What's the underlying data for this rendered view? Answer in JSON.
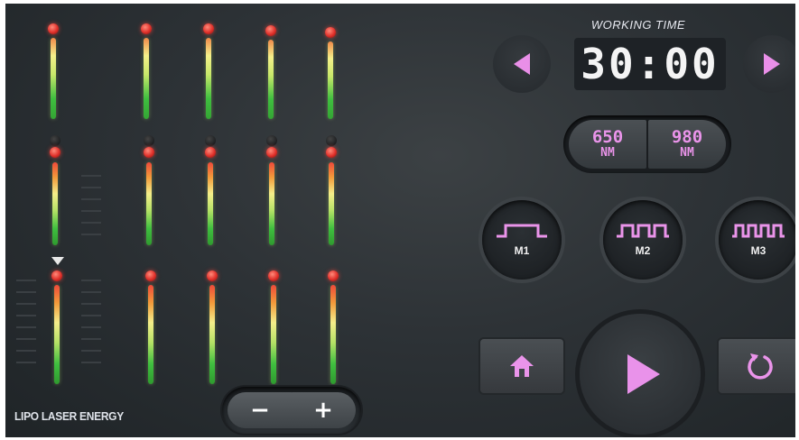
{
  "energy_label": "LIPO LASER ENERGY",
  "controls": {
    "minus_label": "−",
    "plus_label": "+"
  },
  "working_time": {
    "label": "WORKING TIME",
    "value": "30:00"
  },
  "wavelengths": [
    {
      "value": "650",
      "unit": "NM"
    },
    {
      "value": "980",
      "unit": "NM"
    }
  ],
  "modes": [
    {
      "label": "M1"
    },
    {
      "label": "M2"
    },
    {
      "label": "M3"
    }
  ],
  "colors": {
    "accent": "#e98fe8",
    "background": "#2d3236",
    "indicator_red": "#e0302a",
    "indicator_green": "#3fbf3f"
  },
  "icons": {
    "prev": "triangle-left-icon",
    "next": "triangle-right-icon",
    "home": "home-icon",
    "play": "play-icon",
    "reset": "refresh-icon"
  }
}
